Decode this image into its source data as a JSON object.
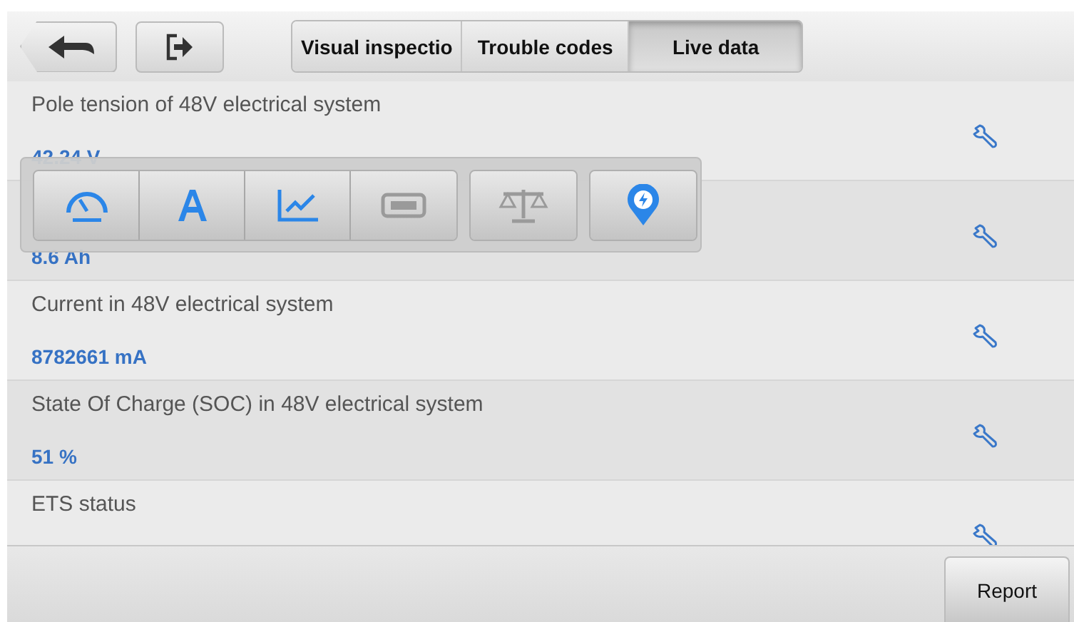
{
  "tabs": [
    {
      "label": "Visual inspectio",
      "selected": false
    },
    {
      "label": "Trouble codes",
      "selected": false
    },
    {
      "label": "Live data",
      "selected": true
    }
  ],
  "rows": [
    {
      "label": "Pole tension of 48V electrical system",
      "value": "42.24 V"
    },
    {
      "value": "8.6 Ah"
    },
    {
      "label": "Current in 48V electrical system",
      "value": "8782661 mA"
    },
    {
      "label": "State Of Charge (SOC) in 48V electrical system",
      "value": "51 %"
    },
    {
      "label": "ETS status"
    }
  ],
  "display_modes": [
    {
      "groups": [
        {
          "kind": "gauge",
          "disabled": false
        },
        {
          "kind": "text",
          "disabled": false
        },
        {
          "kind": "chart",
          "disabled": false
        },
        {
          "kind": "bar",
          "disabled": true
        }
      ]
    },
    {
      "groups": [
        {
          "kind": "scale",
          "disabled": true
        }
      ]
    },
    {
      "groups": [
        {
          "kind": "pin",
          "disabled": false
        }
      ]
    }
  ],
  "report_button": "Report"
}
